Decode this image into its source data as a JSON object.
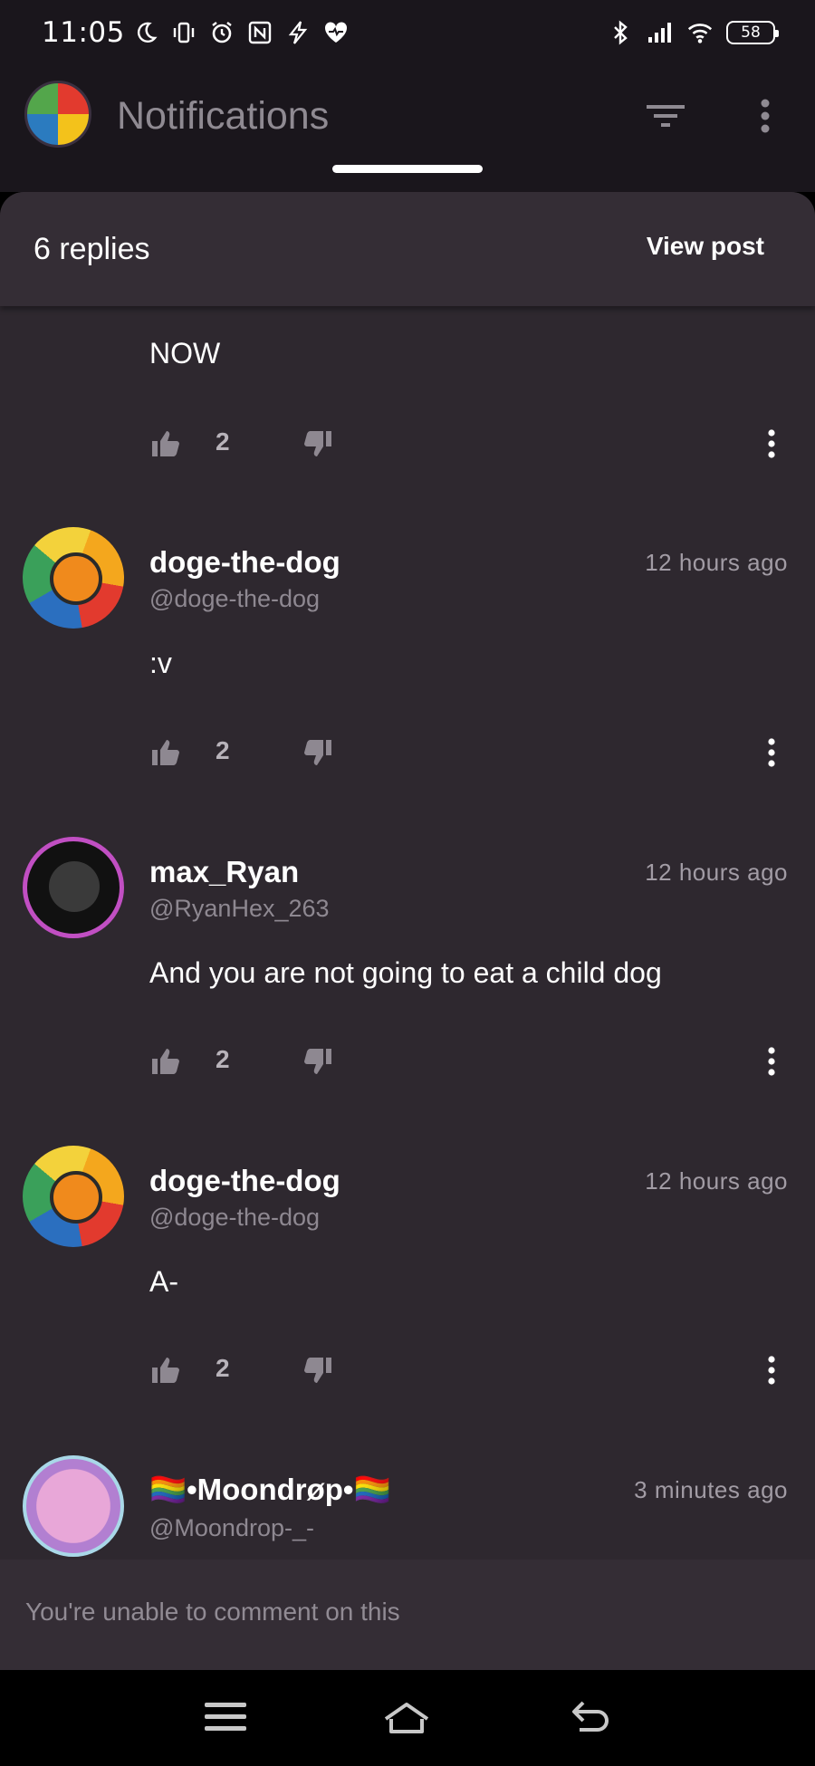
{
  "status_bar": {
    "time": "11:05",
    "battery": "58",
    "left_icons": [
      "moon-icon",
      "vibrate-icon",
      "alarm-icon",
      "nfc-icon",
      "flash-icon",
      "heart-icon"
    ],
    "right_icons": [
      "bluetooth-icon",
      "signal-icon",
      "wifi-icon",
      "battery-icon"
    ]
  },
  "app_bar": {
    "title": "Notifications",
    "icons": [
      "avatar",
      "filter-icon",
      "more-vert-icon"
    ]
  },
  "sheet": {
    "replies_label": "6 replies",
    "view_post_label": "View post"
  },
  "comments": [
    {
      "username": "",
      "handle": "",
      "time": "",
      "text": "NOW",
      "likes": "2"
    },
    {
      "username": "doge-the-dog",
      "handle": "@doge-the-dog",
      "time": "12 hours ago",
      "text": ":v",
      "likes": "2"
    },
    {
      "username": "max_Ryan",
      "handle": "@RyanHex_263",
      "time": "12 hours ago",
      "text": "And you are not going to eat a child dog",
      "likes": "2"
    },
    {
      "username": "doge-the-dog",
      "handle": "@doge-the-dog",
      "time": "12 hours ago",
      "text": "A-",
      "likes": "2"
    },
    {
      "username": "🏳️‍🌈•Moondrøp•🏳️‍🌈",
      "handle": "@Moondrop-_-",
      "time": "3 minutes ago",
      "text": "",
      "likes": ""
    }
  ],
  "footer": {
    "notice": "You're unable to comment on this"
  },
  "nav_bar": {
    "icons": [
      "menu-icon",
      "home-icon",
      "back-icon"
    ]
  },
  "colors": {
    "background": "#2e282f",
    "header": "#342d35",
    "appbar": "#1a161c",
    "text_primary": "#ffffff",
    "text_secondary": "#8e8891"
  }
}
